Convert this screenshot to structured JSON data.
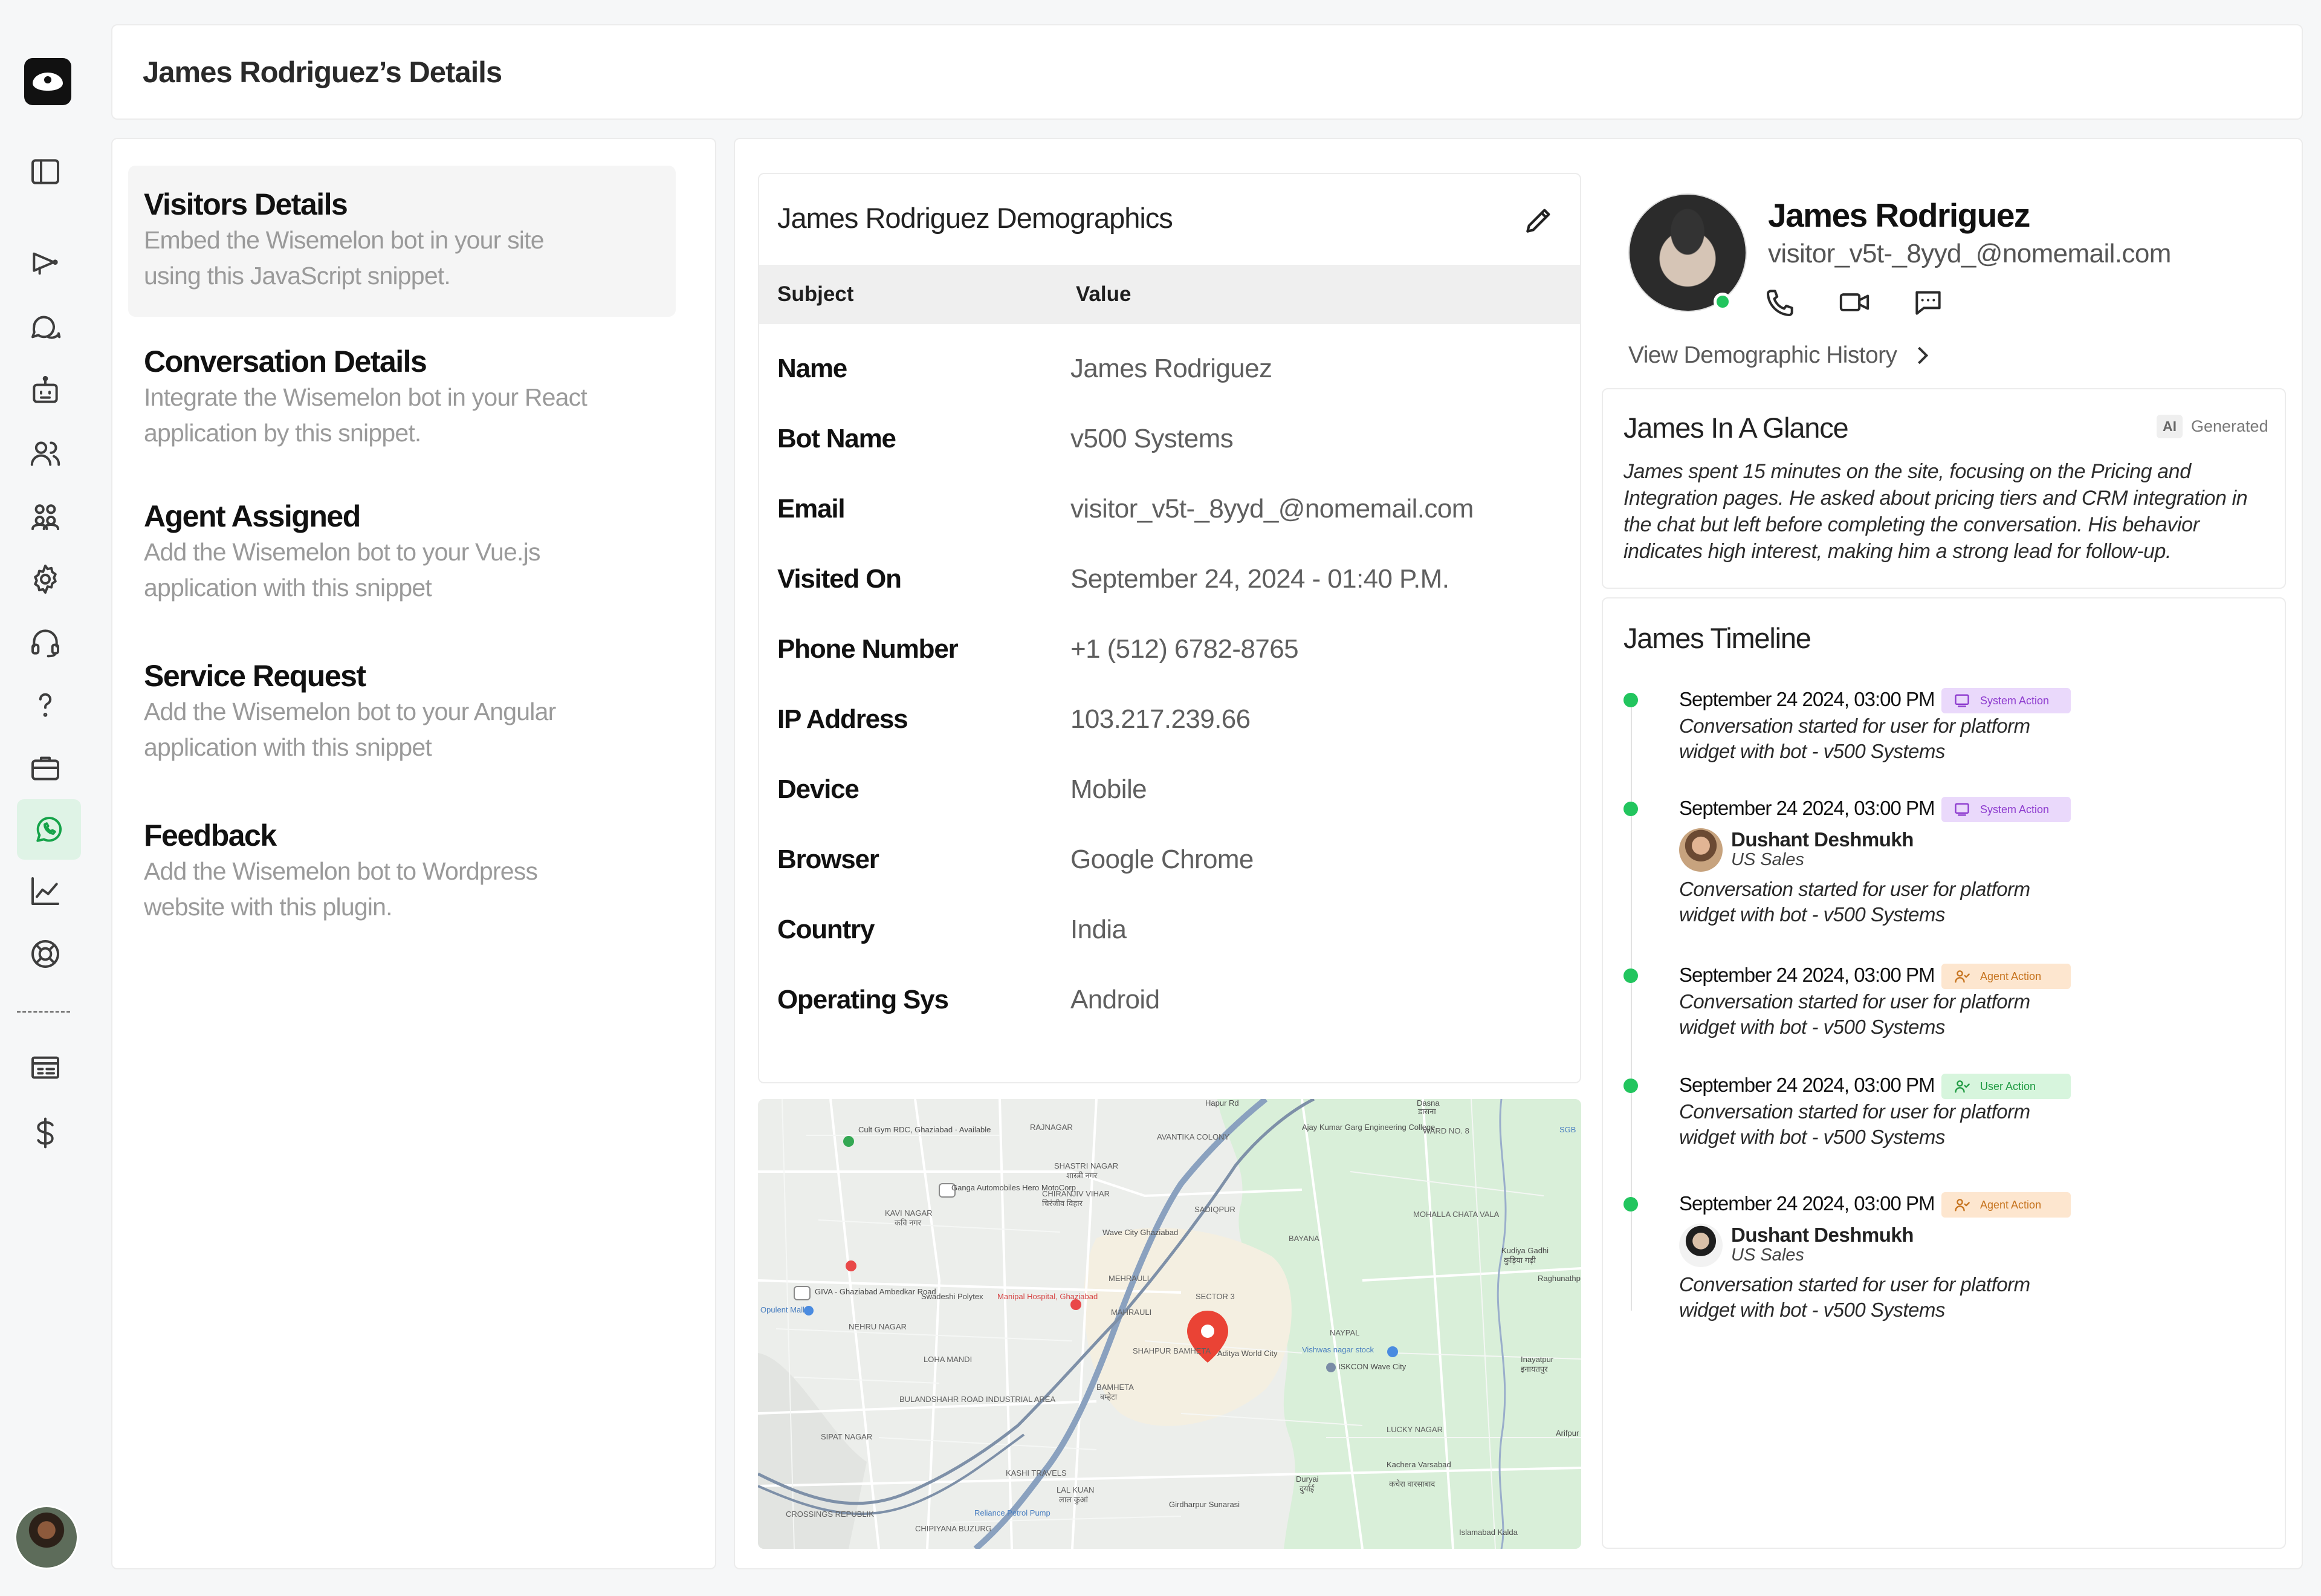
{
  "header": {
    "title": "James Rodriguez’s Details"
  },
  "sidebar": {
    "icons": [
      "sidebar-panel-icon",
      "megaphone-icon",
      "chat-bubbles-icon",
      "bot-icon",
      "users-icon",
      "team-icon",
      "gear-icon",
      "headset-icon",
      "help-icon",
      "briefcase-icon",
      "whatsapp-icon",
      "chart-icon",
      "lifebuoy-icon",
      "invoice-icon",
      "dollar-icon"
    ],
    "active": "whatsapp-icon",
    "separator": "------"
  },
  "left_nav": [
    {
      "title": "Visitors Details",
      "desc": "Embed the Wisemelon bot in your site using this JavaScript snippet."
    },
    {
      "title": "Conversation Details",
      "desc": "Integrate the Wisemelon bot in your React application by this  snippet."
    },
    {
      "title": "Agent Assigned",
      "desc": "Add the Wisemelon bot to your Vue.js application with this snippet"
    },
    {
      "title": "Service Request",
      "desc": "Add the Wisemelon bot to your Angular application with this snippet"
    },
    {
      "title": "Feedback",
      "desc": "Add the Wisemelon bot to Wordpress website with this plugin."
    }
  ],
  "demographics": {
    "title": "James Rodriguez Demographics",
    "col_subject": "Subject",
    "col_value": "Value",
    "rows": [
      {
        "k": "Name",
        "v": "James Rodriguez"
      },
      {
        "k": "Bot Name",
        "v": "v500 Systems"
      },
      {
        "k": "Email",
        "v": "visitor_v5t-_8yyd_@nomemail.com"
      },
      {
        "k": "Visited On",
        "v": "September 24, 2024 - 01:40 P.M."
      },
      {
        "k": "Phone Number",
        "v": "+1 (512) 6782-8765"
      },
      {
        "k": "IP Address",
        "v": "103.217.239.66"
      },
      {
        "k": "Device",
        "v": "Mobile"
      },
      {
        "k": "Browser",
        "v": "Google Chrome"
      },
      {
        "k": "Country",
        "v": "India"
      },
      {
        "k": "Operating Sys",
        "v": "Android"
      }
    ]
  },
  "map": {
    "labels": [
      "SHASTRI NAGAR",
      "शास्त्री नगर",
      "CHIRANJIV VIHAR",
      "चिरंजीव विहार",
      "KAVI NAGAR",
      "कवि नगर",
      "RAJNAGAR",
      "AVANTIKA COLONY",
      "Ganga Automobiles Hero MotoCorp",
      "Cult Gym RDC, Ghaziabad · Available",
      "Manipal Hospital, Ghaziabad",
      "GIVA - Ghaziabad Ambedkar Road",
      "Swadeshi Polytex",
      "Opulent Mall",
      "NEHRU NAGAR",
      "LOHA MANDI",
      "BULANDSHAHR ROAD INDUSTRIAL AREA",
      "BAMHETA",
      "बम्हेटा",
      "LAL KUAN",
      "लाल कुआं",
      "KASHI TRAVELS",
      "Reliance Petrol Pump",
      "Aditya World City",
      "Vishwas nagar stock",
      "ISKCON Wave City",
      "NAYPAL",
      "LUCKY NAGAR",
      "Kachera Varsabad",
      "कचेरा वारसाबाद",
      "Duryai",
      "दुर्याई",
      "Girdharpur Sunarasi",
      "Islamabad Kalda",
      "Inayatpur",
      "इनायतपुर",
      "Kudiya Gadhi",
      "कुड़िया गढ़ी",
      "Raghunathpur",
      "Arifpur",
      "Dasna",
      "डासना",
      "SADIQPUR",
      "BAYANA",
      "MOHALLA CHATA VALA",
      "SECTOR 3",
      "WARD NO. 8",
      "MEHRAULI",
      "MAHRAULI",
      "SHAHPUR BAMHETA",
      "Wave City Ghaziabad",
      "Ajay Kumar Garg Engineering College",
      "SIPAT NAGAR",
      "CROSSINGS REPUBLIK",
      "CHIPIYANA BUZURG",
      "Hapur Rd",
      "SGB"
    ]
  },
  "profile": {
    "name": "James Rodriguez",
    "email": "visitor_v5t-_8yyd_@nomemail.com",
    "history_link": "View Demographic History"
  },
  "glance": {
    "title": "James In A Glance",
    "ai": "AI",
    "generated": "Generated",
    "text": "James spent 15 minutes on the site, focusing on the Pricing and Integration pages. He asked about pricing tiers and CRM integration in the chat but left before completing the conversation. His behavior indicates high interest, making him a strong lead for follow-up."
  },
  "timeline": {
    "title": "James Timeline",
    "entries": [
      {
        "date": "September 24 2024, 03:00 PM",
        "tag": "System Action",
        "desc": "Conversation started for user for platform widget with bot - v500 Systems"
      },
      {
        "date": "September 24 2024, 03:00 PM",
        "tag": "System Action",
        "agent": "Dushant Deshmukh",
        "role": "US Sales",
        "desc": "Conversation started for user for platform widget with bot - v500 Systems"
      },
      {
        "date": "September 24 2024, 03:00 PM",
        "tag": "Agent Action",
        "desc": "Conversation started for user for platform widget with bot - v500 Systems"
      },
      {
        "date": "September 24 2024, 03:00 PM",
        "tag": "User Action",
        "desc": "Conversation started for user for platform widget with bot - v500 Systems"
      },
      {
        "date": "September 24 2024, 03:00 PM",
        "tag": "Agent Action",
        "agent": "Dushant Deshmukh",
        "role": "US Sales",
        "desc": "Conversation started for user for platform widget with bot - v500 Systems"
      }
    ]
  }
}
